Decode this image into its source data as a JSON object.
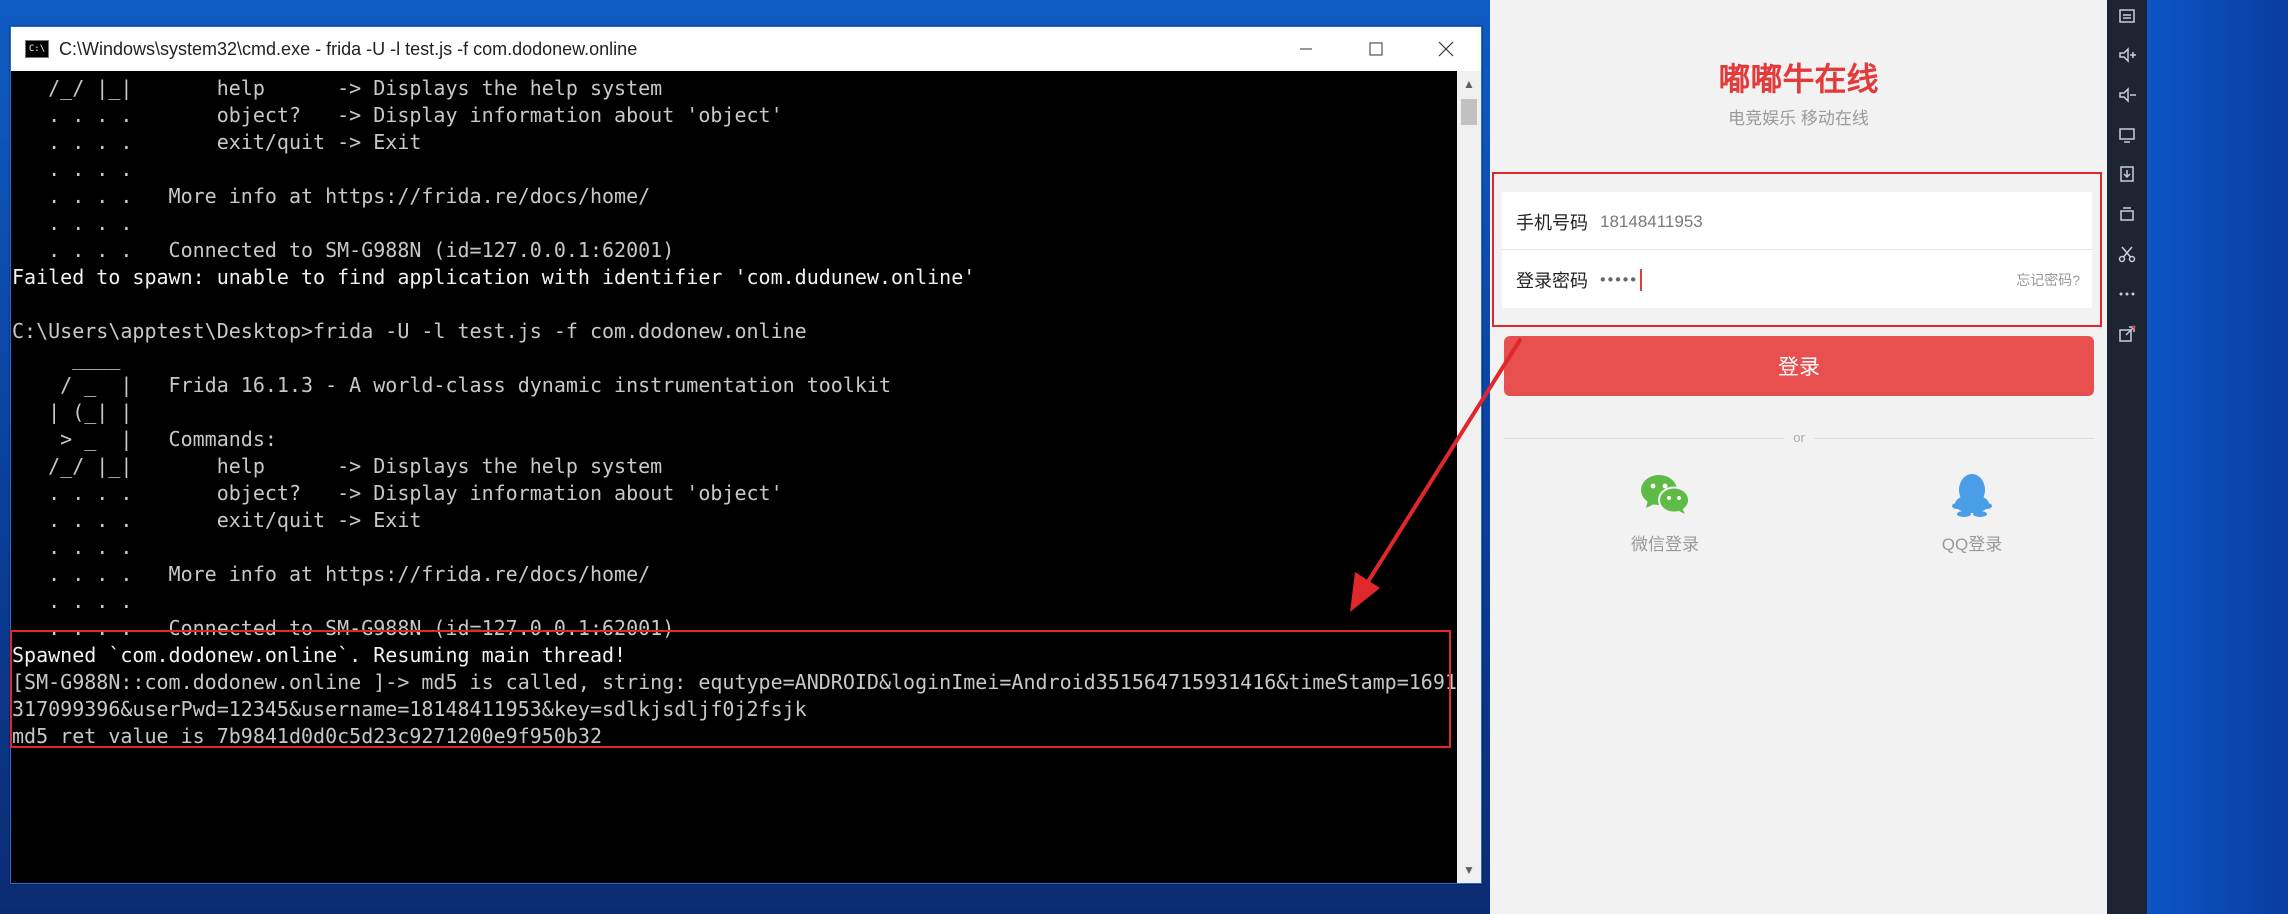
{
  "terminal": {
    "title": "C:\\Windows\\system32\\cmd.exe - frida  -U -l test.js -f com.dodonew.online",
    "icon_text": "C:\\",
    "lines": [
      "   /_/ |_|       help      -> Displays the help system",
      "   . . . .       object?   -> Display information about 'object'",
      "   . . . .       exit/quit -> Exit",
      "   . . . .",
      "   . . . .   More info at https://frida.re/docs/home/",
      "   . . . .",
      "   . . . .   Connected to SM-G988N (id=127.0.0.1:62001)",
      "Failed to spawn: unable to find application with identifier 'com.dudunew.online'",
      "",
      "C:\\Users\\apptest\\Desktop>frida -U -l test.js -f com.dodonew.online",
      "     ____",
      "    / _  |   Frida 16.1.3 - A world-class dynamic instrumentation toolkit",
      "   | (_| |",
      "    > _  |   Commands:",
      "   /_/ |_|       help      -> Displays the help system",
      "   . . . .       object?   -> Display information about 'object'",
      "   . . . .       exit/quit -> Exit",
      "   . . . .",
      "   . . . .   More info at https://frida.re/docs/home/",
      "   . . . .",
      "   . . . .   Connected to SM-G988N (id=127.0.0.1:62001)",
      "Spawned `com.dodonew.online`. Resuming main thread!",
      "[SM-G988N::com.dodonew.online ]-> md5 is called, string: equtype=ANDROID&loginImei=Android351564715931416&timeStamp=1691",
      "317099396&userPwd=12345&username=18148411953&key=sdlkjsdljf0j2fsjk",
      "md5 ret value is 7b9841d0d0c5d23c9271200e9f950b32"
    ]
  },
  "app": {
    "title": "嘟嘟牛在线",
    "subtitle": "电竞娱乐 移动在线",
    "phone_label": "手机号码",
    "phone_value": "18148411953",
    "password_label": "登录密码",
    "password_mask": "•••••",
    "forgot_label": "忘记密码?",
    "login_label": "登录",
    "or_label": "or",
    "wechat_label": "微信登录",
    "qq_label": "QQ登录"
  },
  "colors": {
    "accent_red": "#e33b3b",
    "login_button": "#e85050",
    "wechat_green": "#5dbb46",
    "qq_blue": "#4a9ee8",
    "annotation_red": "#e0282c"
  },
  "toolbar": {
    "icons": [
      "keyboard-icon",
      "volume-up-icon",
      "volume-down-icon",
      "screen-icon",
      "install-apk-icon",
      "shake-icon",
      "scissors-icon",
      "more-icon",
      "share-out-icon"
    ]
  }
}
